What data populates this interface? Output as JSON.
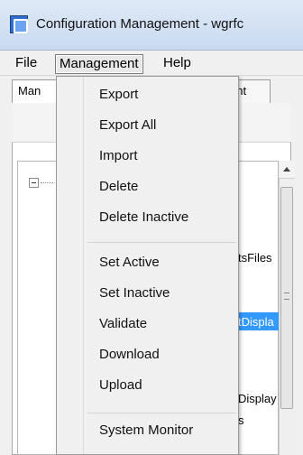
{
  "window": {
    "title": "Configuration Management - wgrfc"
  },
  "menubar": {
    "file": "File",
    "management": "Management",
    "help": "Help"
  },
  "tabs": [
    {
      "label": "Man"
    },
    {
      "label": "nment"
    }
  ],
  "tree": {
    "fragments": [
      "tsFiles",
      "tDispla",
      "Display",
      "s"
    ],
    "bottom_item": "..."
  },
  "management_menu": {
    "items": [
      {
        "label": "Export"
      },
      {
        "label": "Export All"
      },
      {
        "label": "Import"
      },
      {
        "label": "Delete"
      },
      {
        "label": "Delete Inactive"
      },
      {
        "label": "Set Active"
      },
      {
        "label": "Set Inactive"
      },
      {
        "label": "Validate"
      },
      {
        "label": "Download"
      },
      {
        "label": "Upload"
      },
      {
        "label": "System Monitor"
      }
    ]
  }
}
